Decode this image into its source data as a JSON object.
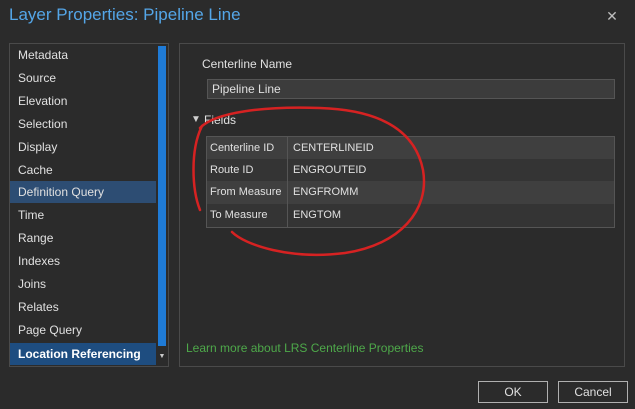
{
  "window": {
    "title": "Layer Properties: Pipeline Line",
    "close_glyph": "✕"
  },
  "sidebar": {
    "items": [
      {
        "label": "Metadata"
      },
      {
        "label": "Source"
      },
      {
        "label": "Elevation"
      },
      {
        "label": "Selection"
      },
      {
        "label": "Display"
      },
      {
        "label": "Cache"
      },
      {
        "label": "Definition Query"
      },
      {
        "label": "Time"
      },
      {
        "label": "Range"
      },
      {
        "label": "Indexes"
      },
      {
        "label": "Joins"
      },
      {
        "label": "Relates"
      },
      {
        "label": "Page Query"
      },
      {
        "label": "Location Referencing"
      }
    ],
    "hover_item": "Definition Query",
    "selected_item": "Location Referencing"
  },
  "panel": {
    "centerline_name_label": "Centerline Name",
    "centerline_name_value": "Pipeline Line",
    "fields_label": "Fields",
    "fields": [
      {
        "name": "Centerline ID",
        "value": "CENTERLINEID"
      },
      {
        "name": "Route ID",
        "value": "ENGROUTEID"
      },
      {
        "name": "From Measure",
        "value": "ENGFROMM"
      },
      {
        "name": "To Measure",
        "value": "ENGTOM"
      }
    ],
    "link_text": "Learn more about LRS Centerline Properties"
  },
  "footer": {
    "ok_label": "OK",
    "cancel_label": "Cancel"
  },
  "colors": {
    "title": "#54a6e8",
    "selected": "#1e4d80",
    "hover": "#2d4d73",
    "link": "#4ea94a",
    "annotation": "#d62222"
  }
}
